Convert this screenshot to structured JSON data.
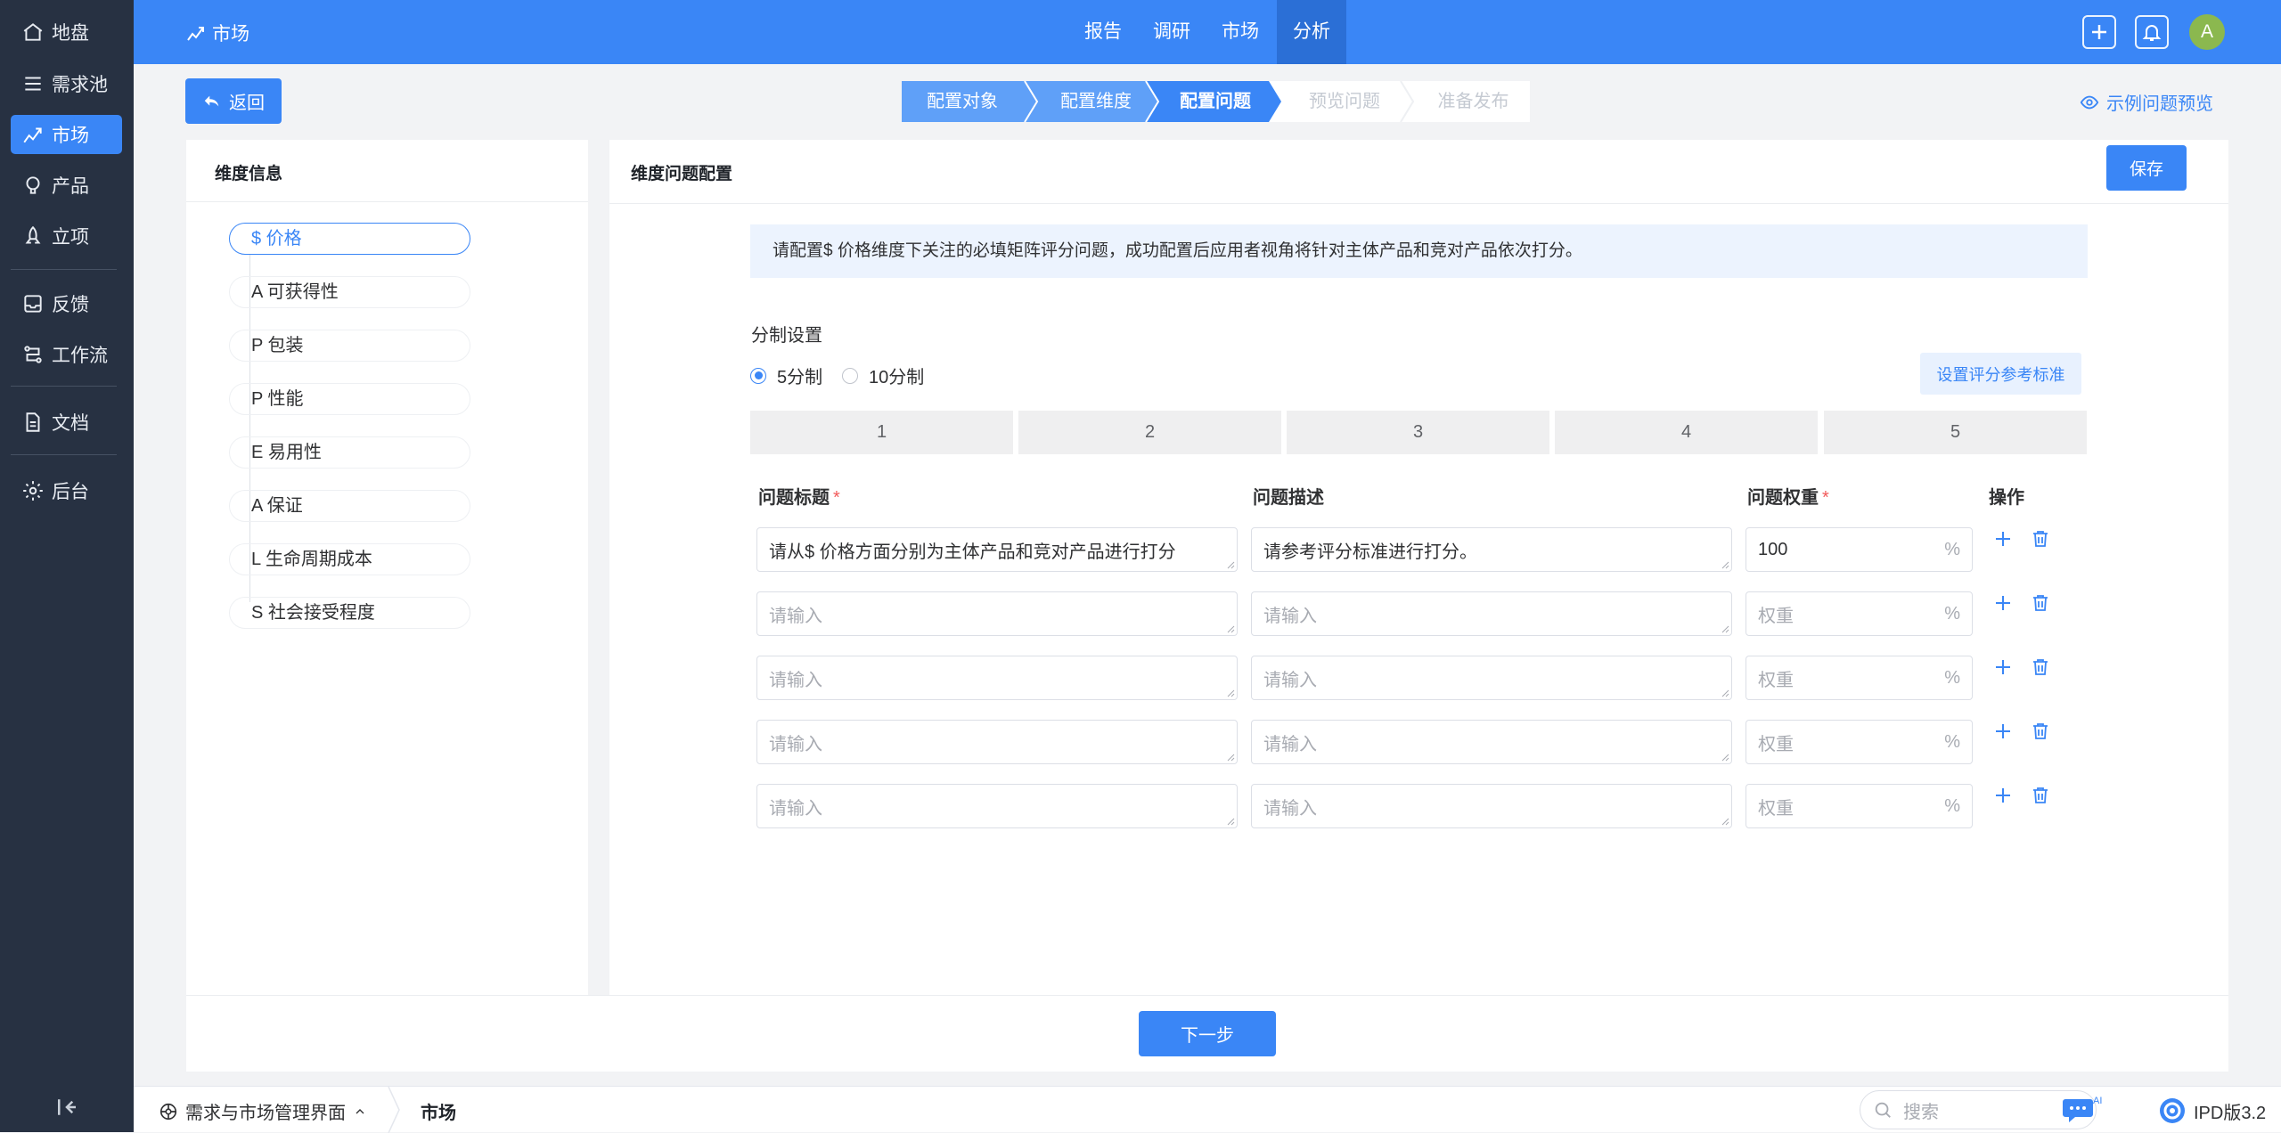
{
  "sidebar": {
    "items": [
      {
        "label": "地盘",
        "icon": "home-icon"
      },
      {
        "label": "需求池",
        "icon": "list-icon"
      },
      {
        "label": "市场",
        "icon": "chart-trend-icon"
      },
      {
        "label": "产品",
        "icon": "bulb-icon"
      },
      {
        "label": "立项",
        "icon": "rocket-icon"
      },
      {
        "label": "反馈",
        "icon": "inbox-icon"
      },
      {
        "label": "工作流",
        "icon": "workflow-icon"
      },
      {
        "label": "文档",
        "icon": "document-icon"
      },
      {
        "label": "后台",
        "icon": "gear-icon"
      }
    ],
    "active_index": 2
  },
  "topbar": {
    "title": "市场",
    "tabs": [
      "报告",
      "调研",
      "市场",
      "分析"
    ],
    "active_tab": 3,
    "avatar": "A"
  },
  "back_label": "返回",
  "steps": [
    {
      "label": "配置对象",
      "state": "done"
    },
    {
      "label": "配置维度",
      "state": "done"
    },
    {
      "label": "配置问题",
      "state": "current"
    },
    {
      "label": "预览问题",
      "state": "todo"
    },
    {
      "label": "准备发布",
      "state": "todo"
    }
  ],
  "preview_link": "示例问题预览",
  "left_panel": {
    "title": "维度信息",
    "dimensions": [
      "$ 价格",
      "A 可获得性",
      "P 包装",
      "P 性能",
      "E 易用性",
      "A 保证",
      "L 生命周期成本",
      "S 社会接受程度"
    ],
    "active_index": 0
  },
  "right_panel": {
    "title": "维度问题配置",
    "save_label": "保存",
    "notice": "请配置$ 价格维度下关注的必填矩阵评分问题，成功配置后应用者视角将针对主体产品和竞对产品依次打分。",
    "scale_label": "分制设置",
    "scale_options": [
      "5分制",
      "10分制"
    ],
    "scale_selected": 0,
    "ref_button": "设置评分参考标准",
    "scale_values": [
      "1",
      "2",
      "3",
      "4",
      "5"
    ],
    "table": {
      "headers": {
        "title": "问题标题",
        "desc": "问题描述",
        "weight": "问题权重",
        "ops": "操作"
      },
      "required_mark": "*",
      "placeholder": "请输入",
      "weight_placeholder": "权重",
      "unit": "%",
      "rows": [
        {
          "title": "请从$ 价格方面分别为主体产品和竞对产品进行打分",
          "desc": "请参考评分标准进行打分。",
          "weight": "100"
        },
        {
          "title": "",
          "desc": "",
          "weight": ""
        },
        {
          "title": "",
          "desc": "",
          "weight": ""
        },
        {
          "title": "",
          "desc": "",
          "weight": ""
        },
        {
          "title": "",
          "desc": "",
          "weight": ""
        }
      ]
    }
  },
  "next_label": "下一步",
  "statusbar": {
    "breadcrumb_root": "需求与市场管理界面",
    "breadcrumb_current": "市场",
    "search_placeholder": "搜索",
    "ai_badge": "AI",
    "version": "IPD版3.2"
  }
}
